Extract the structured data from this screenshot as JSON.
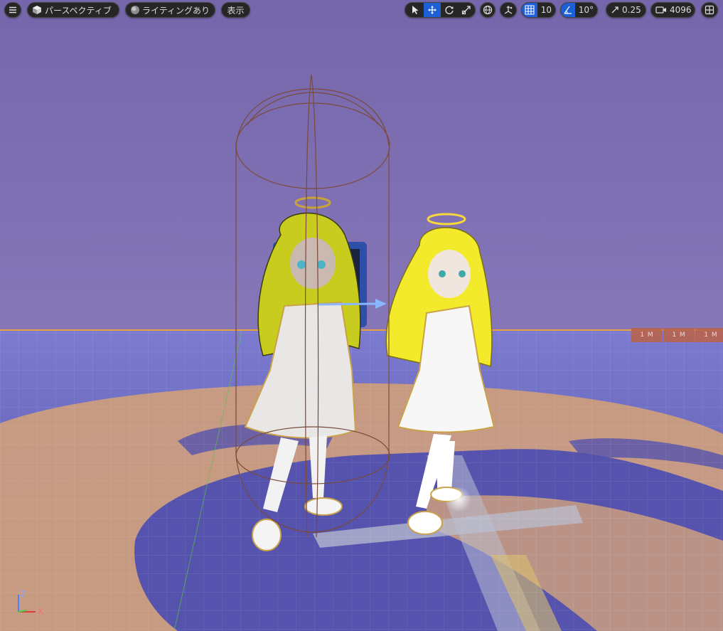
{
  "toolbar": {
    "menu_icon": "hamburger-icon",
    "view_mode": {
      "icon": "cube-icon",
      "label": "パースペクティブ"
    },
    "lighting": {
      "icon": "sphere-icon",
      "label": "ライティングあり"
    },
    "show": {
      "label": "表示"
    },
    "transform_tools": [
      {
        "icon": "select-arrow-icon",
        "active": false
      },
      {
        "icon": "move-icon",
        "active": true
      },
      {
        "icon": "rotate-icon",
        "active": false
      },
      {
        "icon": "scale-icon",
        "active": false
      }
    ],
    "world_space_icon": "globe-icon",
    "surface_snap_icon": "surface-snap-icon",
    "grid_snap": {
      "icon": "grid-icon",
      "value": "10"
    },
    "rotation_snap": {
      "icon": "angle-icon",
      "value": "10°"
    },
    "scale_snap": {
      "icon": "scale-arrow-icon",
      "value": "0.25"
    },
    "camera_speed": {
      "icon": "camera-icon",
      "value": "4096"
    },
    "layout_icon": "viewport-layout-icon"
  },
  "scene": {
    "scale_markers": [
      "1 M",
      "1 M",
      "1 M"
    ],
    "axis": {
      "z": "Z",
      "x": "X"
    },
    "colors": {
      "sky": "#7c6fb0",
      "floor_blue": "#4f4fa6",
      "floor_tan": "#c79a82",
      "horizon_line": "#e8a040",
      "selection": "#1d5fd6",
      "capsule": "#7a4a3a"
    }
  }
}
